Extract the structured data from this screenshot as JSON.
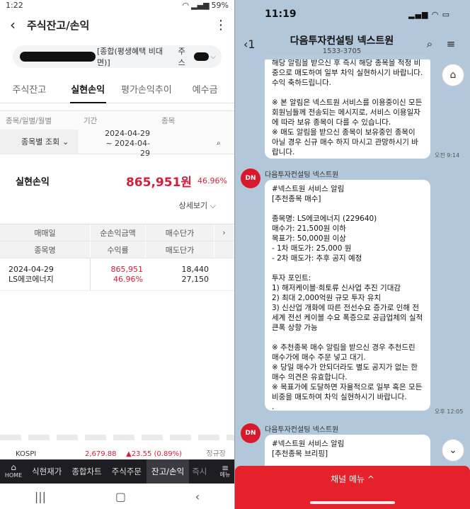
{
  "left": {
    "status": {
      "time": "1:22",
      "battery": "59%"
    },
    "header": {
      "title": "주식잔고/손익"
    },
    "account": {
      "type": "[종합(평생혜택 비대면)]",
      "suffix": "주스"
    },
    "tabs": [
      "주식잔고",
      "실현손익",
      "평가손익추이",
      "예수금"
    ],
    "filter": {
      "label_kind": "종목/일별/월별",
      "label_period": "기간",
      "label_stock": "종목",
      "select_value": "종목별 조회",
      "date_from": "2024-04-29",
      "date_to": "~ 2024-04-29"
    },
    "realized": {
      "label": "실현손익",
      "amount": "865,951원",
      "rate": "46.96%"
    },
    "detail_link": "상세보기",
    "table": {
      "headers_row1": [
        "매매일",
        "순손익금액",
        "매수단가"
      ],
      "headers_row2": [
        "종목명",
        "수익률",
        "매도단가"
      ],
      "rows": [
        {
          "date": "2024-04-29",
          "name": "LS에코에너지",
          "profit": "865,951",
          "rate": "46.96%",
          "buy": "18,440",
          "sell": "27,150"
        }
      ]
    },
    "ticker": {
      "name": "KOSPI",
      "value": "2,679.88",
      "change": "▲23.55 (0.89%)",
      "right": "정규장"
    },
    "bottom_nav": {
      "home": "HOME",
      "items": [
        "식현재가",
        "종합차트",
        "주식주문",
        "잔고/손익",
        "즉시"
      ],
      "menu": "메뉴"
    }
  },
  "right": {
    "status": {
      "time": "11:19"
    },
    "header": {
      "name": "다음투자컨설팅 넥스트원",
      "phone": "1533-3705"
    },
    "msg1": {
      "text": "해당 알림을 받으신 후 즉시 해당 종목을 적정 비중으로 매도하여 일부 차익 실현하시기 바랍니다. 수익 축하드립니다.\n\n※ 본 알림은 넥스트원 서비스를 이용중이신 모든 회원님들께 전송되는 메시지로, 서비스 이용일자에 따라 보유 종목이 다를 수 있습니다.\n※ 매도 알림을 받으신 종목이 보유중인 종목이 아닐 경우 신규 매수 하지 마시고 관망하시기 바랍니다.",
      "time": "오전 9:14"
    },
    "sender": "다음투자컨설팅 넥스트원",
    "msg2": {
      "text": "#넥스트원 서비스 알림\n[추천종목 매수]\n\n종목명: LS에코에너지 (229640)\n매수가: 21,500원 이하\n목표가: 50,000원 이상\n- 1차 매도가: 25,000 원\n- 2차 매도가: 추후 공지 예정\n\n투자 포인트:\n1) 해저케이블·희토류 신사업 추진 기대감\n2) 최대 2,000억원 규모 투자 유치\n3) 신산업 개화에 따른 전선수요 증가로 인해 전세계 전선 케이블 수요 폭증으로 공급업체의 실적 큰폭 상향 가능\n\n※ 추천종목 매수 알림을 받으신 경우 추천드린 매수가에 매수 주문 넣고 대기.\n※ 당일 매수가 안되더라도 별도 공지가 없는 한 매수 의견은 유효합니다.\n※ 목표가에 도달하면 자율적으로 일부 혹은 모든 비중을 매도하여 차익 실현하시기 바랍니다.\n.",
      "time": "오후 12:05"
    },
    "msg3": {
      "text": "#넥스트원 서비스 알림\n[추천종목 브리핑]"
    },
    "avatar_label": "DN",
    "channel_menu": "채널 메뉴 ^"
  }
}
